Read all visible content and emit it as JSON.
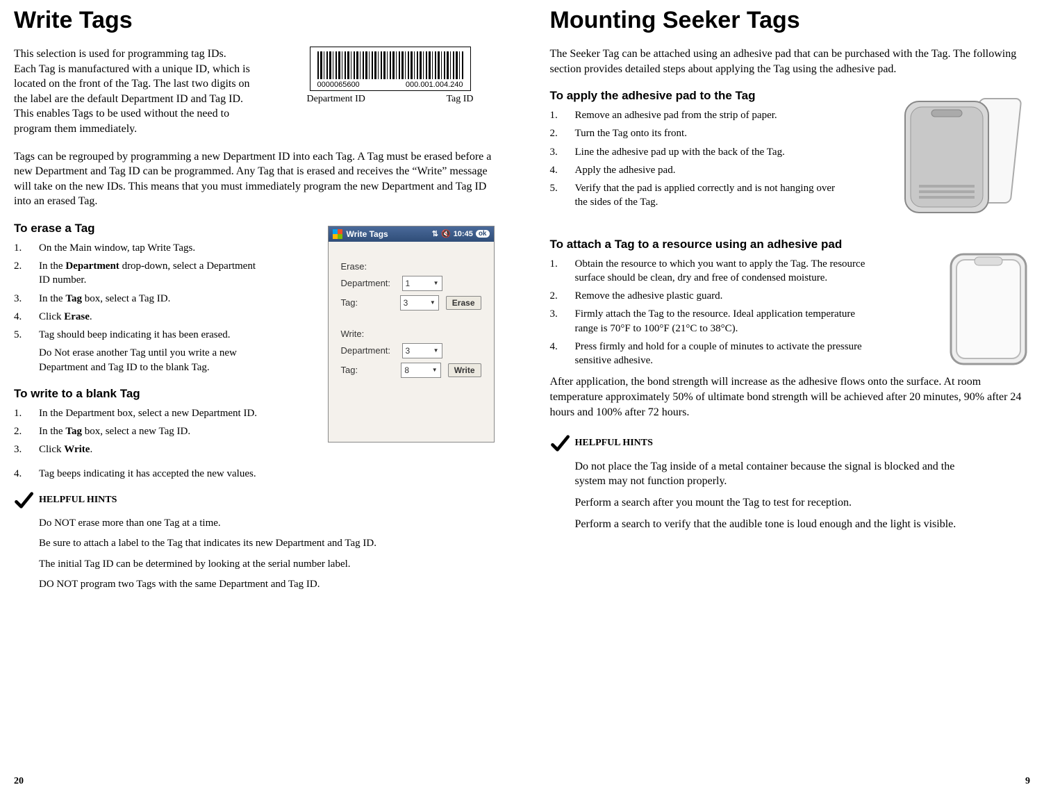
{
  "left": {
    "title": "Write Tags",
    "intro1": "This selection is used for programming tag IDs. Each Tag is manufactured with a unique ID, which is located on the front of the Tag. The last two digits on the label are the default Department ID and Tag ID. This enables Tags to be used without the need to program them immediately.",
    "barcode": {
      "num_left": "0000065600",
      "num_right": "000.001.004.240",
      "label_left": "Department ID",
      "label_right": "Tag ID"
    },
    "intro2": "Tags can be regrouped by programming a new Department ID into each Tag. A Tag must be erased before a new Department and Tag ID can be programmed. Any Tag that is erased and receives the “Write” message will take on the new IDs. This means that you must immediately program the new Department and Tag ID into an erased Tag.",
    "h2_erase": "To erase a Tag",
    "erase_steps": {
      "s1": "On the Main window, tap Write Tags.",
      "s2a": "In the ",
      "s2b": "Department",
      "s2c": " drop-down, select a Department ID number.",
      "s3a": "In the ",
      "s3b": "Tag",
      "s3c": " box, select a Tag ID.",
      "s4a": "Click ",
      "s4b": "Erase",
      "s4c": ".",
      "s5": "Tag should beep indicating it has been erased.",
      "s5note": "Do Not erase another Tag until you write a new Department and Tag ID to the blank Tag."
    },
    "h2_write": "To write to a blank Tag",
    "write_steps": {
      "s1": "In the Department box, select a new Department ID.",
      "s2a": "In the ",
      "s2b": "Tag",
      "s2c": " box, select a new Tag ID.",
      "s3a": "Click ",
      "s3b": "Write",
      "s3c": ".",
      "s4": "Tag beeps indicating it has accepted the new values."
    },
    "hints_title": "HELPFUL HINTS",
    "hints": {
      "h1": "Do NOT erase more than one Tag at a time.",
      "h2": "Be sure to attach a label to the Tag that indicates its new Department and Tag ID.",
      "h3": "The initial Tag ID can be determined by looking at the serial number label.",
      "h4": "DO NOT program two Tags with the same Department and Tag ID."
    },
    "app": {
      "title": "Write Tags",
      "time": "10:45",
      "ok": "ok",
      "erase_label": "Erase:",
      "write_label": "Write:",
      "dept_label": "Department:",
      "tag_label": "Tag:",
      "erase_dept": "1",
      "erase_tag": "3",
      "write_dept": "3",
      "write_tag": "8",
      "erase_btn": "Erase",
      "write_btn": "Write"
    },
    "page_num": "20"
  },
  "right": {
    "title": "Mounting Seeker Tags",
    "intro": "The Seeker Tag can be attached using an adhesive pad that can be purchased with the Tag. The following section provides detailed steps about applying the Tag using the adhesive pad.",
    "h2_apply": "To apply the adhesive pad to the Tag",
    "apply_steps": {
      "s1": "Remove an adhesive pad from the strip of paper.",
      "s2": "Turn the Tag onto its front.",
      "s3": "Line the adhesive pad up with the back of the Tag.",
      "s4": "Apply the adhesive pad.",
      "s5": "Verify that the pad is applied correctly and is not hanging over the sides of the Tag."
    },
    "h2_attach": "To attach a Tag to a resource using an adhesive pad",
    "attach_steps": {
      "s1": "Obtain the resource to which you want to apply the Tag. The resource surface should be clean, dry and free of condensed moisture.",
      "s2": "Remove the adhesive plastic guard.",
      "s3": "Firmly attach the Tag to the resource. Ideal application temperature range is 70°F to 100°F (21°C to 38°C).",
      "s4": "Press firmly and hold for a couple of minutes to activate the pressure sensitive adhesive."
    },
    "attach_note": " After application, the bond strength will increase as the adhesive flows onto the surface. At room temperature approximately 50% of ultimate bond strength will be achieved after 20 minutes, 90% after 24 hours and 100% after 72 hours.",
    "hints_title": "HELPFUL HINTS",
    "hints": {
      "h1": "Do not place the Tag inside of a metal container because the signal is blocked and the system may not function properly.",
      "h2": "Perform a search after you mount the Tag to test for reception.",
      "h3": "Perform a search to verify that the audible tone is loud enough and the light is visible."
    },
    "page_num": "9"
  }
}
